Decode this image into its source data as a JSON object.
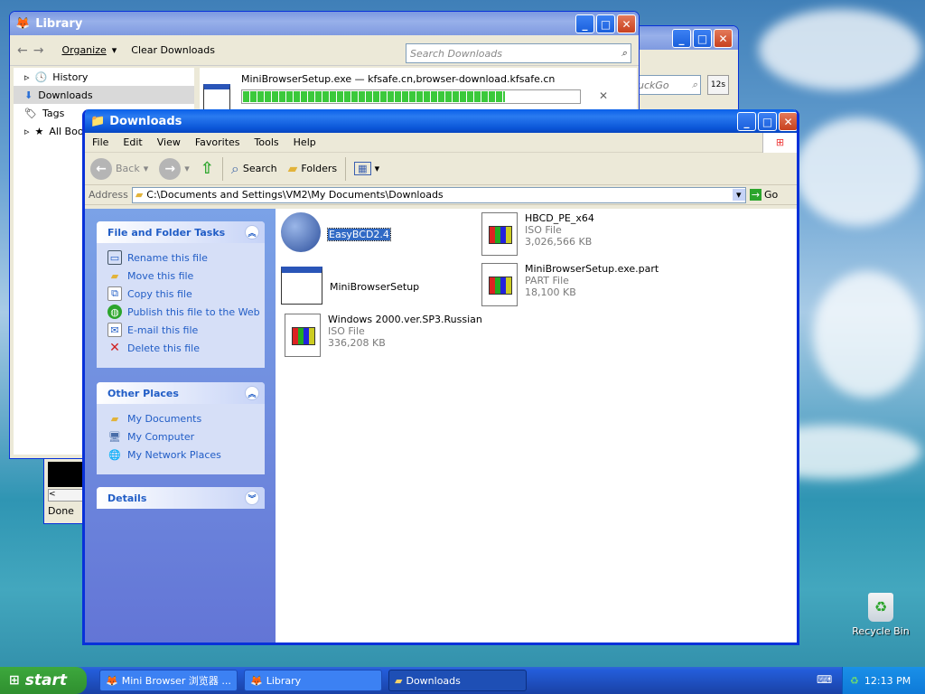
{
  "library": {
    "title": "Library",
    "organize": "Organize",
    "clear": "Clear Downloads",
    "search_placeholder": "Search Downloads",
    "nav": [
      "History",
      "Downloads",
      "Tags",
      "All Bookm"
    ],
    "dl_name": "MiniBrowserSetup.exe — kfsafe.cn,browser-download.kfsafe.cn",
    "progress": 0.78
  },
  "bgwin": {
    "search_text": "uckGo",
    "badge": "12s",
    "status": "Done"
  },
  "explorer": {
    "title": "Downloads",
    "menu": [
      "File",
      "Edit",
      "View",
      "Favorites",
      "Tools",
      "Help"
    ],
    "back": "Back",
    "search": "Search",
    "folders": "Folders",
    "address_label": "Address",
    "address": "C:\\Documents and Settings\\VM2\\My Documents\\Downloads",
    "go": "Go",
    "tasks_title": "File and Folder Tasks",
    "tasks": [
      "Rename this file",
      "Move this file",
      "Copy this file",
      "Publish this file to the Web",
      "E-mail this file",
      "Delete this file"
    ],
    "places_title": "Other Places",
    "places": [
      "My Documents",
      "My Computer",
      "My Network Places"
    ],
    "details_title": "Details",
    "files": [
      {
        "name": "EasyBCD2.4"
      },
      {
        "name": "HBCD_PE_x64",
        "type": "ISO File",
        "size": "3,026,566 KB"
      },
      {
        "name": "MiniBrowserSetup"
      },
      {
        "name": "MiniBrowserSetup.exe.part",
        "type": "PART File",
        "size": "18,100 KB"
      },
      {
        "name": "Windows 2000.ver.SP3.Russian",
        "type": "ISO File",
        "size": "336,208 KB"
      }
    ]
  },
  "desktop": {
    "recycle": "Recycle Bin"
  },
  "taskbar": {
    "start": "start",
    "items": [
      "Mini Browser 浏览器 ...",
      "Library",
      "Downloads"
    ],
    "time": "12:13 PM"
  }
}
